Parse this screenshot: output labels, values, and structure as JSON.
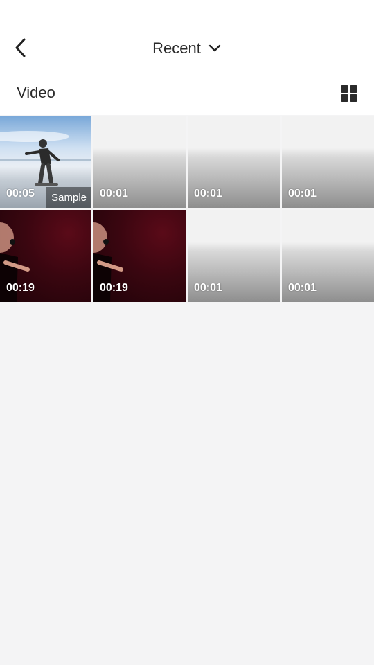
{
  "header": {
    "title": "Recent",
    "section_label": "Video"
  },
  "icons": {
    "back": "back-arrow-icon",
    "dropdown": "chevron-down-icon",
    "layout": "grid-view-icon"
  },
  "videos": [
    {
      "duration": "00:05",
      "badge": "Sample",
      "thumb": "snowboard"
    },
    {
      "duration": "00:01",
      "thumb": "grey"
    },
    {
      "duration": "00:01",
      "thumb": "grey"
    },
    {
      "duration": "00:01",
      "thumb": "grey"
    },
    {
      "duration": "00:19",
      "thumb": "concert"
    },
    {
      "duration": "00:19",
      "thumb": "concert"
    },
    {
      "duration": "00:01",
      "thumb": "grey"
    },
    {
      "duration": "00:01",
      "thumb": "grey"
    }
  ],
  "colors": {
    "background": "#f4f4f5",
    "header_bg": "#ffffff",
    "text": "#2a2a2a"
  }
}
